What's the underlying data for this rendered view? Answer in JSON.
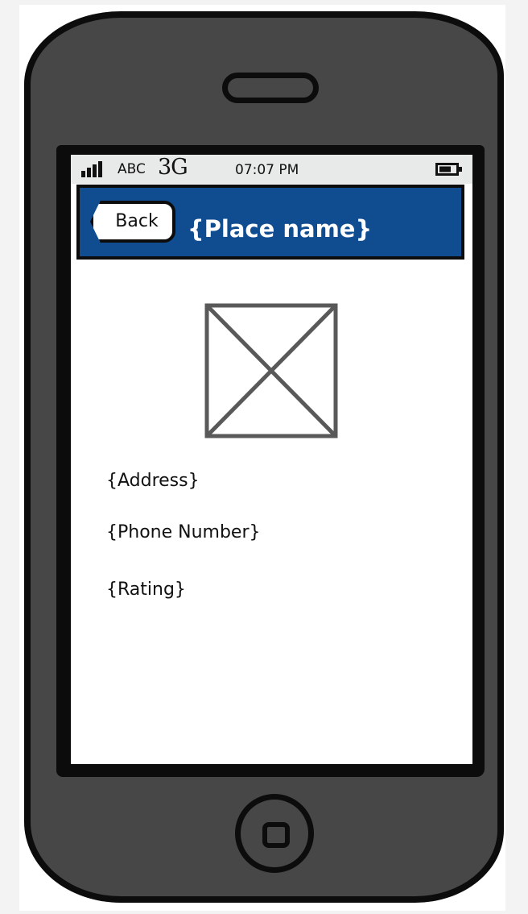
{
  "status_bar": {
    "carrier": "ABC",
    "network": "3G",
    "time": "07:07 PM",
    "icons": [
      "signal-bars-icon",
      "battery-icon"
    ]
  },
  "nav_bar": {
    "back_label": "Back",
    "title": "{Place name}"
  },
  "content": {
    "image_icon": "image-placeholder-icon",
    "address": "{Address}",
    "phone": "{Phone Number}",
    "rating": "{Rating}"
  },
  "device": {
    "icons": [
      "speaker-icon",
      "home-button-icon"
    ]
  },
  "colors": {
    "nav_background": "#0f4c90",
    "phone_body": "#474747",
    "outline": "#0c0c0c",
    "screen": "#ffffff",
    "status_bar": "#e8eaea"
  }
}
